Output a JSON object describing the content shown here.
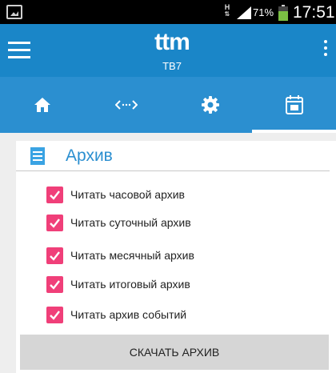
{
  "status_bar": {
    "network_type": "H",
    "battery_percent": "71%",
    "time": "17:51"
  },
  "app_bar": {
    "logo_text": "ttm",
    "subtitle": "ТВ7"
  },
  "tabs": [
    {
      "icon": "home-icon",
      "active": false
    },
    {
      "icon": "connection-icon",
      "active": false
    },
    {
      "icon": "settings-gear-icon",
      "active": false
    },
    {
      "icon": "calendar-icon",
      "active": true
    }
  ],
  "archive": {
    "title": "Архив",
    "options": [
      {
        "label": "Читать часовой архив",
        "checked": true
      },
      {
        "label": "Читать суточный архив",
        "checked": true
      },
      {
        "label": "Читать месячный архив",
        "checked": true
      },
      {
        "label": "Читать итоговый архив",
        "checked": true
      },
      {
        "label": "Читать архив событий",
        "checked": true
      }
    ],
    "download_label": "СКАЧАТЬ АРХИВ"
  },
  "colors": {
    "app_bar": "#1a86c8",
    "tab_bar": "#2b8fd0",
    "checkbox": "#f03f79",
    "section_title": "#2b8fd0"
  }
}
